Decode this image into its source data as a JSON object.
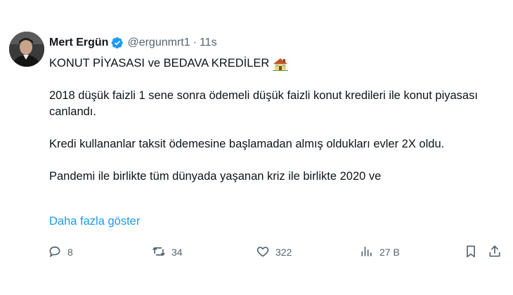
{
  "author": {
    "name": "Mert Ergün",
    "handle": "@ergunmrt1",
    "separator": "·",
    "time": "11s"
  },
  "tweet": {
    "title": "KONUT PİYASASI ve BEDAVA KREDİLER",
    "paragraph1": "2018 düşük faizli 1 sene sonra ödemeli düşük faizli konut kredileri ile konut piyasası canlandı.",
    "paragraph2": "Kredi kullananlar taksit ödemesine başlamadan almış oldukları evler 2X oldu.",
    "paragraph3": "Pandemi ile birlikte tüm dünyada yaşanan kriz ile birlikte 2020 ve",
    "show_more": "Daha fazla göster"
  },
  "actions": {
    "replies": "8",
    "retweets": "34",
    "likes": "322",
    "views": "27 B"
  },
  "icons": {
    "verified": "verified-badge-icon",
    "house": "house-emoji-icon",
    "reply": "reply-icon",
    "retweet": "retweet-icon",
    "like": "heart-icon",
    "views": "views-icon",
    "bookmark": "bookmark-icon",
    "share": "share-icon"
  },
  "colors": {
    "verified": "#1d9bf0",
    "link": "#1d9bf0",
    "muted": "#536471",
    "text": "#0f1419"
  }
}
